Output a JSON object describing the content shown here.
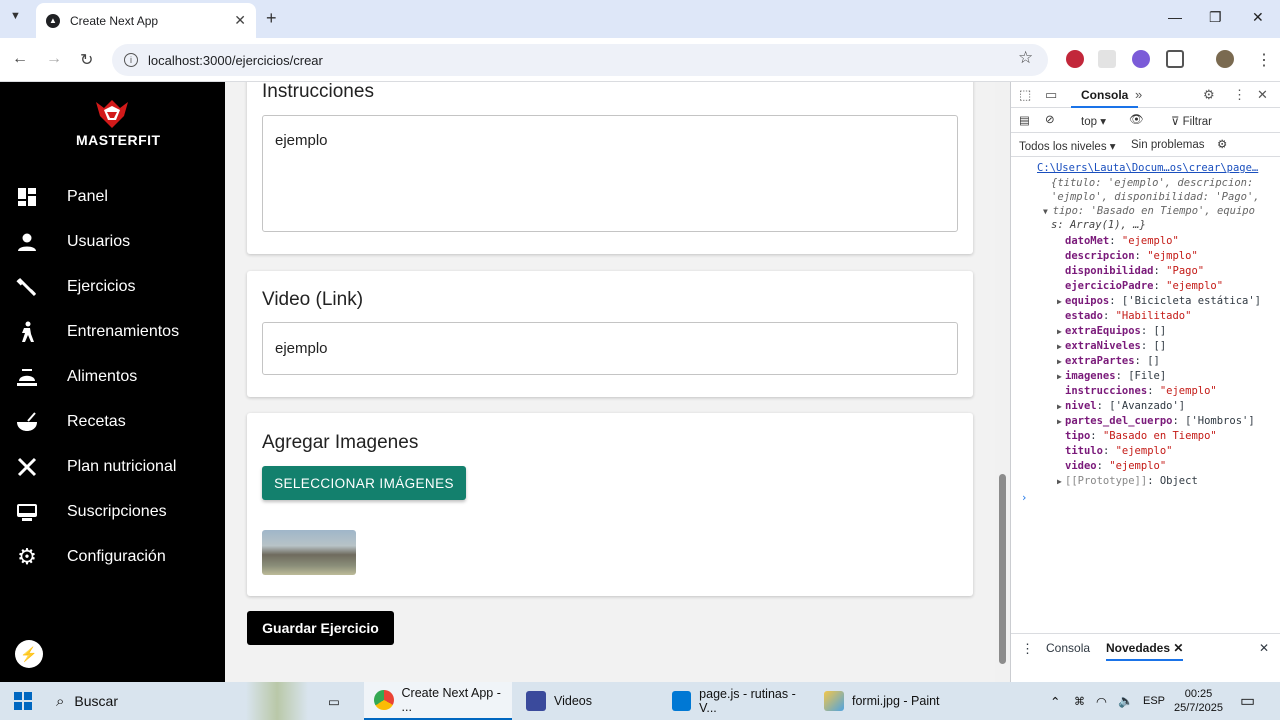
{
  "browser": {
    "tab_title": "Create Next App",
    "url": "localhost:3000/ejercicios/crear"
  },
  "sidebar": {
    "brand": "MASTERFIT",
    "items": [
      {
        "label": "Panel",
        "icon": "dashboard-icon"
      },
      {
        "label": "Usuarios",
        "icon": "person-icon"
      },
      {
        "label": "Ejercicios",
        "icon": "fitness-icon"
      },
      {
        "label": "Entrenamientos",
        "icon": "walk-icon"
      },
      {
        "label": "Alimentos",
        "icon": "food-tray-icon"
      },
      {
        "label": "Recetas",
        "icon": "soup-icon"
      },
      {
        "label": "Plan nutricional",
        "icon": "cutlery-icon"
      },
      {
        "label": "Suscripciones",
        "icon": "card-icon"
      },
      {
        "label": "Configuración",
        "icon": "gear-icon"
      }
    ]
  },
  "form": {
    "instrucciones_label": "Instrucciones",
    "instrucciones_value": "ejemplo",
    "video_label": "Video (Link)",
    "video_value": "ejemplo",
    "imagenes_label": "Agregar Imagenes",
    "select_images_button": "SELECCIONAR IMÁGENES",
    "save_button": "Guardar Ejercicio"
  },
  "devtools": {
    "tab_console": "Consola",
    "filter_placeholder": "Filtrar",
    "context": "top",
    "levels": "Todos los niveles",
    "issues": "Sin problemas",
    "source_link": "C:\\Users\\Lauta\\Docum…os\\crear\\page…",
    "summary": [
      "{titulo: 'ejemplo', descripcion:",
      "'ejmplo', disponibilidad: 'Pago',",
      "tipo: 'Basado en Tiempo', equipo",
      "s: Array(1), …}"
    ],
    "entries": [
      {
        "key": "datoMet",
        "value": "\"ejemplo\"",
        "expandable": false
      },
      {
        "key": "descripcion",
        "value": "\"ejmplo\"",
        "expandable": false
      },
      {
        "key": "disponibilidad",
        "value": "\"Pago\"",
        "expandable": false
      },
      {
        "key": "ejercicioPadre",
        "value": "\"ejemplo\"",
        "expandable": false
      },
      {
        "key": "equipos",
        "value": "['Bicicleta estática']",
        "expandable": true
      },
      {
        "key": "estado",
        "value": "\"Habilitado\"",
        "expandable": false
      },
      {
        "key": "extraEquipos",
        "value": "[]",
        "expandable": true
      },
      {
        "key": "extraNiveles",
        "value": "[]",
        "expandable": true
      },
      {
        "key": "extraPartes",
        "value": "[]",
        "expandable": true
      },
      {
        "key": "imagenes",
        "value": "[File]",
        "expandable": true
      },
      {
        "key": "instrucciones",
        "value": "\"ejemplo\"",
        "expandable": false
      },
      {
        "key": "nivel",
        "value": "['Avanzado']",
        "expandable": true
      },
      {
        "key": "partes_del_cuerpo",
        "value": "['Hombros']",
        "expandable": true
      },
      {
        "key": "tipo",
        "value": "\"Basado en Tiempo\"",
        "expandable": false
      },
      {
        "key": "titulo",
        "value": "\"ejemplo\"",
        "expandable": false
      },
      {
        "key": "video",
        "value": "\"ejemplo\"",
        "expandable": false
      },
      {
        "key": "[[Prototype]]",
        "value": "Object",
        "expandable": true
      }
    ],
    "bottom_tab_console": "Consola",
    "bottom_tab_news": "Novedades"
  },
  "taskbar": {
    "search": "Buscar",
    "apps": [
      {
        "label": "Create Next App - ...",
        "active": true
      },
      {
        "label": "Videos",
        "active": false
      },
      {
        "label": "page.js - rutinas - V...",
        "active": false
      },
      {
        "label": "formi.jpg - Paint",
        "active": false
      }
    ],
    "lang": "ESP",
    "time": "00:25",
    "date": "25/7/2025"
  },
  "colors": {
    "accent_green": "#13806d",
    "sidebar_bg": "#000000",
    "logo_red": "#d21a1a"
  }
}
